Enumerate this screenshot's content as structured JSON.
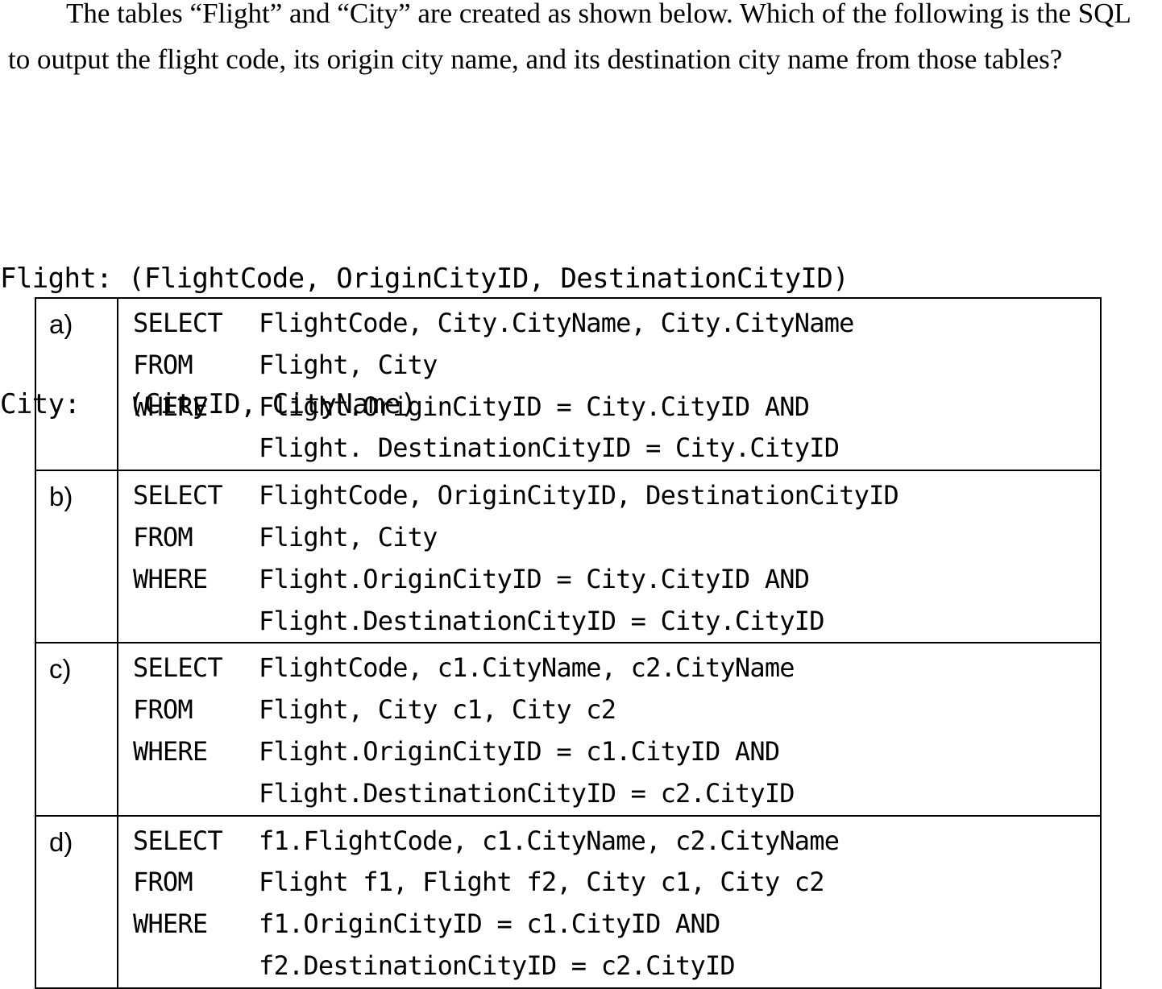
{
  "question": {
    "text": "The tables “Flight” and “City” are created as shown below. Which of the following is the SQL to output the flight code, its origin city name, and its destination city name from those tables?"
  },
  "schema": {
    "lines": [
      "Flight: (FlightCode, OriginCityID, DestinationCityID)",
      "City:   (CityID, CityName)"
    ]
  },
  "options": [
    {
      "label": "a)",
      "lines": [
        {
          "keyword": "SELECT",
          "expr": "FlightCode, City.CityName, City.CityName"
        },
        {
          "keyword": "FROM",
          "expr": "Flight, City"
        },
        {
          "keyword": "WHERE",
          "expr": "Flight.OriginCityID = City.CityID AND"
        },
        {
          "keyword": "",
          "expr": "Flight. DestinationCityID = City.CityID"
        }
      ]
    },
    {
      "label": "b)",
      "lines": [
        {
          "keyword": "SELECT",
          "expr": "FlightCode, OriginCityID, DestinationCityID"
        },
        {
          "keyword": "FROM",
          "expr": "Flight, City"
        },
        {
          "keyword": "WHERE",
          "expr": "Flight.OriginCityID = City.CityID AND"
        },
        {
          "keyword": "",
          "expr": "Flight.DestinationCityID = City.CityID"
        }
      ]
    },
    {
      "label": "c)",
      "lines": [
        {
          "keyword": "SELECT",
          "expr": "FlightCode, c1.CityName, c2.CityName"
        },
        {
          "keyword": "FROM",
          "expr": "Flight, City c1, City c2"
        },
        {
          "keyword": "WHERE",
          "expr": "Flight.OriginCityID = c1.CityID AND"
        },
        {
          "keyword": "",
          "expr": "Flight.DestinationCityID = c2.CityID"
        }
      ]
    },
    {
      "label": "d)",
      "lines": [
        {
          "keyword": "SELECT",
          "expr": "f1.FlightCode, c1.CityName, c2.CityName"
        },
        {
          "keyword": "FROM",
          "expr": "Flight f1, Flight f2, City c1, City c2"
        },
        {
          "keyword": "WHERE",
          "expr": "f1.OriginCityID = c1.CityID AND"
        },
        {
          "keyword": "",
          "expr": "f2.DestinationCityID = c2.CityID"
        }
      ]
    }
  ]
}
